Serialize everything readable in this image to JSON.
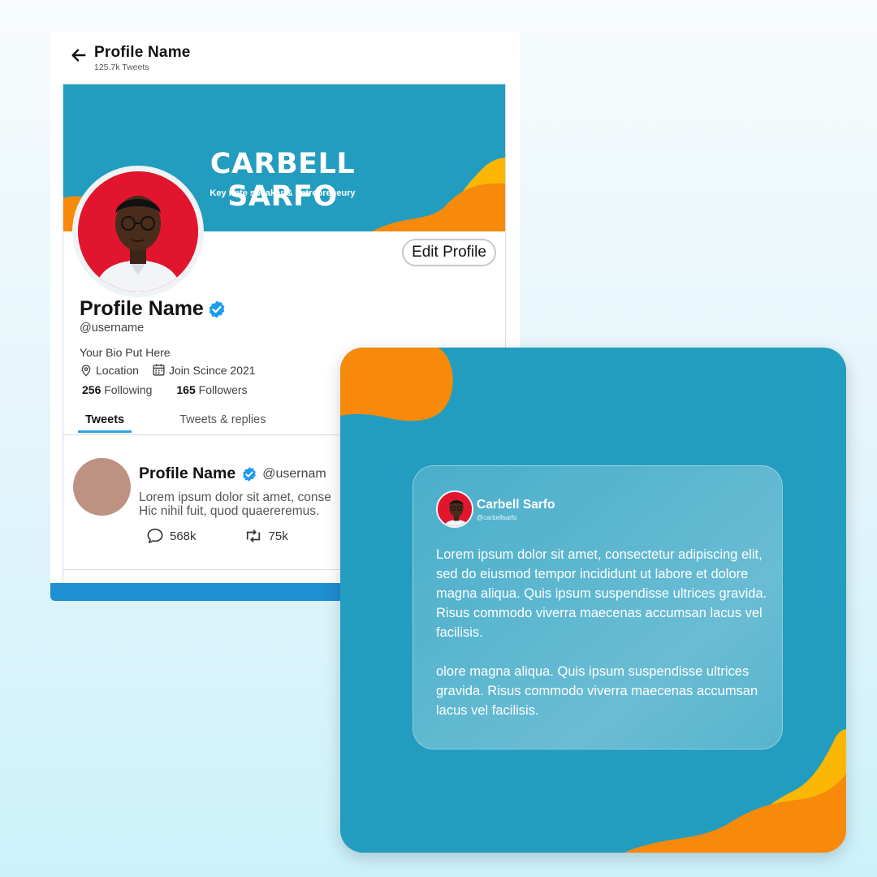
{
  "profile_page": {
    "title": "Profile Name",
    "subtitle": "125.7k Tweets",
    "banner": {
      "name": "CARBELL SARFO",
      "tagline": "Key note speaker & entrepreneury"
    },
    "edit_button": "Edit Profile",
    "name": "Profile Name",
    "handle": "@username",
    "bio": "Your Bio Put Here",
    "location": "Location",
    "joined": "Join Scince 2021",
    "following_count": "256",
    "following_label": "Following",
    "followers_count": "165",
    "followers_label": "Followers",
    "tabs": [
      "Tweets",
      "Tweets & replies"
    ],
    "tweet": {
      "name": "Profile Name",
      "handle": "@usernam",
      "text_line1": "Lorem ipsum dolor sit amet, conse",
      "text_line2": "Hic nihil fuit, quod quaereremus.",
      "replies": "568k",
      "retweets": "75k"
    }
  },
  "quote_card": {
    "name": "Carbell Sarfo",
    "handle": "@carbellsarfo",
    "paragraph1": "Lorem ipsum dolor sit amet, consectetur adipiscing elit, sed do eiusmod tempor incididunt ut labore et dolore magna aliqua. Quis ipsum suspendisse ultrices gravida. Risus commodo viverra maecenas accumsan lacus vel facilisis.",
    "paragraph2": "olore magna aliqua. Quis ipsum suspendisse ultrices gravida. Risus commodo viverra maecenas accumsan lacus vel facilisis."
  },
  "colors": {
    "brand_blue": "#239dbf",
    "orange": "#f78a0a",
    "yellow": "#fbb704",
    "accent_blue": "#2ea3e6",
    "avatar_red": "#e1162e"
  }
}
